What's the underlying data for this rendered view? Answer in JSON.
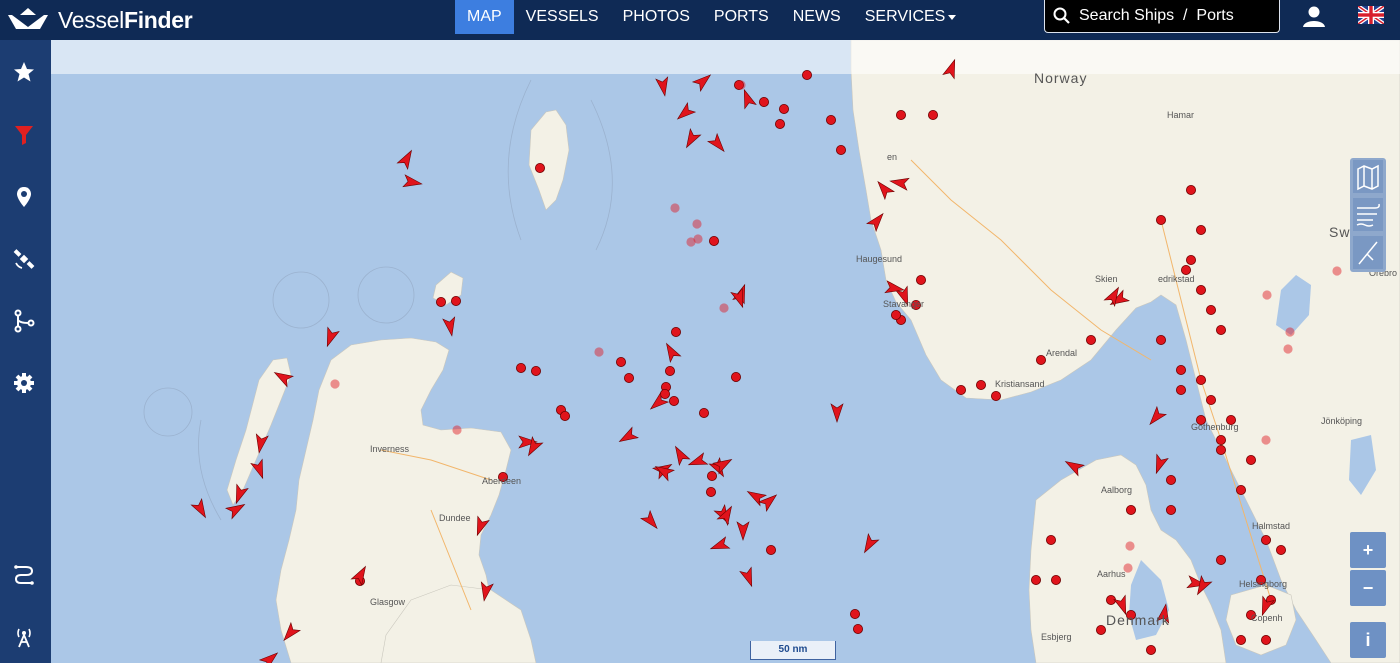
{
  "brand": {
    "prefix": "Vessel",
    "suffix": "Finder"
  },
  "nav": [
    {
      "label": "MAP",
      "active": true
    },
    {
      "label": "VESSELS"
    },
    {
      "label": "PHOTOS"
    },
    {
      "label": "PORTS"
    },
    {
      "label": "NEWS"
    },
    {
      "label": "SERVICES",
      "dropdown": true
    }
  ],
  "search": {
    "placeholder": "Search Ships  /  Ports"
  },
  "sidebar_icons": [
    "star-icon",
    "filter-icon",
    "map-pin-icon",
    "satellite-icon",
    "route-icon",
    "gear-icon",
    "track-icon",
    "antenna-icon"
  ],
  "map": {
    "labels": {
      "norway": "Norway",
      "hamar": "Hamar",
      "bergen": "en",
      "haugesund": "Haugesund",
      "stavanger": "Stavanger",
      "skien": "Skien",
      "fredrikstad": "edrikstad",
      "arendal": "Arendal",
      "kristiansand": "Kristiansand",
      "sweden": "Swed",
      "orebro": "Örebro",
      "gothenburg": "Gothenburg",
      "jonkoping": "Jönköping",
      "aalborg": "Aalborg",
      "halmstad": "Halmstad",
      "helsingborg": "Helsingborg",
      "aarhus": "Aarhus",
      "denmark": "Denmark",
      "copenhagen": "Copenh",
      "esbjerg": "Esbjerg",
      "inverness": "Inverness",
      "aberdeen": "Aberdeen",
      "dundee": "Dundee",
      "glasgow": "Glasgow"
    },
    "scale_label": "50 nm",
    "zoom_in": "+",
    "zoom_out": "−",
    "info": "i",
    "colors": {
      "water": "#abc7e7",
      "land": "#f3f1e6",
      "vessel": "#e0141c",
      "nav_active": "#3d7ee0"
    }
  }
}
